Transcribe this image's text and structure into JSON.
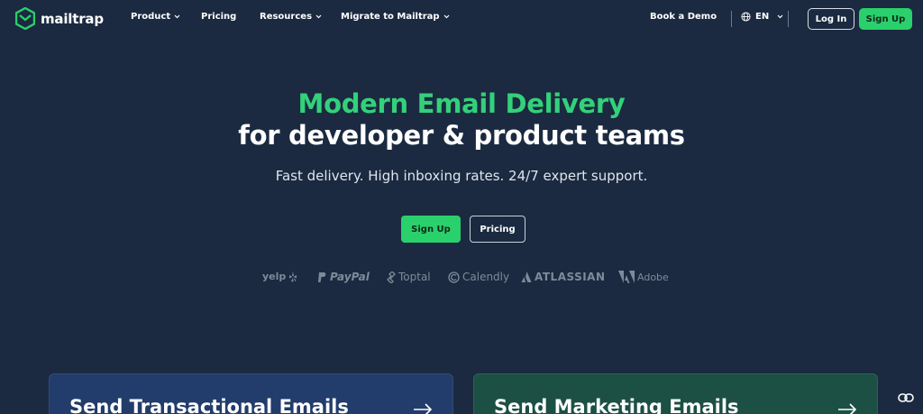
{
  "nav": {
    "logo_text": "mailtrap",
    "items": [
      {
        "label": "Product",
        "has_dropdown": true
      },
      {
        "label": "Pricing",
        "has_dropdown": false
      },
      {
        "label": "Resources",
        "has_dropdown": true
      },
      {
        "label": "Migrate to Mailtrap",
        "has_dropdown": true
      }
    ],
    "book_demo": "Book a Demo",
    "language": "EN",
    "login": "Log In",
    "signup": "Sign Up"
  },
  "hero": {
    "title_line1": "Modern Email Delivery",
    "title_line2": "for developer & product teams",
    "subtitle": "Fast delivery. High inboxing rates. 24/7 expert support.",
    "primary_button": "Sign Up",
    "secondary_button": "Pricing"
  },
  "brands": [
    "yelp",
    "PayPal",
    "Toptal",
    "Calendly",
    "ATLASSIAN",
    "Adobe"
  ],
  "cards": [
    {
      "title": "Send Transactional Emails",
      "icon": "arrow-right-icon"
    },
    {
      "title": "Send Marketing Emails",
      "icon": "arrow-right-icon"
    }
  ],
  "colors": {
    "background": "#1b2a40",
    "accent_green": "#2ad06c",
    "card_blue": "#223c6b",
    "card_green": "#1c5044"
  }
}
